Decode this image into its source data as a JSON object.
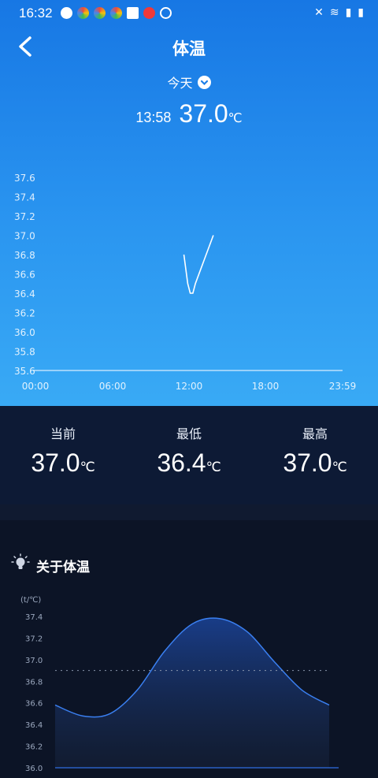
{
  "status_bar": {
    "time": "16:32"
  },
  "header": {
    "title": "体温",
    "date_label": "今天"
  },
  "current_reading": {
    "time": "13:58",
    "value": "37.0",
    "unit": "℃"
  },
  "stats": {
    "current": {
      "label": "当前",
      "value": "37.0",
      "unit": "℃"
    },
    "min": {
      "label": "最低",
      "value": "36.4",
      "unit": "℃"
    },
    "max": {
      "label": "最高",
      "value": "37.0",
      "unit": "℃"
    }
  },
  "about": {
    "title": "关于体温"
  },
  "colors": {
    "top_bg": "#1777e4",
    "dark_bg": "#0c1426",
    "curve": "#3a7ff0"
  },
  "chart_data": [
    {
      "type": "line",
      "title": "",
      "y_ticks": [
        "37.6",
        "37.4",
        "37.2",
        "37.0",
        "36.8",
        "36.6",
        "36.4",
        "36.2",
        "36.0",
        "35.8",
        "35.6"
      ],
      "x_ticks": [
        "00:00",
        "06:00",
        "12:00",
        "18:00",
        "23:59"
      ],
      "ylim": [
        35.6,
        37.6
      ],
      "xlim_hours": [
        0,
        24
      ],
      "series": [
        {
          "x": [
            11.6,
            11.9,
            12.1,
            12.3,
            12.5,
            13.2,
            13.9
          ],
          "y": [
            36.8,
            36.5,
            36.4,
            36.4,
            36.5,
            36.75,
            37.0
          ]
        }
      ],
      "grid": false
    },
    {
      "type": "area",
      "ylabel": "(t/℃)",
      "y_ticks": [
        "37.4",
        "37.2",
        "37.0",
        "36.8",
        "36.6",
        "36.4",
        "36.2",
        "36.0"
      ],
      "ylim": [
        36.0,
        37.4
      ],
      "reference_line": 36.9,
      "series": [
        {
          "x": [
            0,
            0.1,
            0.2,
            0.3,
            0.4,
            0.5,
            0.6,
            0.7,
            0.8,
            0.9,
            1.0
          ],
          "y": [
            36.58,
            36.48,
            36.5,
            36.72,
            37.08,
            37.33,
            37.38,
            37.26,
            36.98,
            36.72,
            36.58
          ]
        }
      ]
    }
  ]
}
